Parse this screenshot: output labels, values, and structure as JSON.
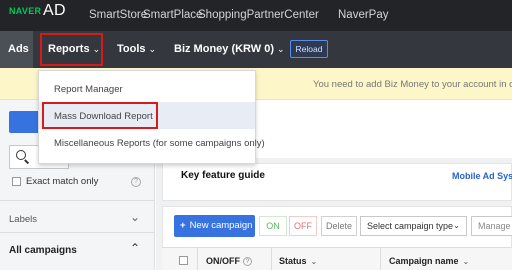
{
  "topbar": {
    "brand": "NAVER",
    "brand_ad": "AD",
    "links": [
      "SmartStore",
      "SmartPlace",
      "ShoppingPartnerCenter",
      "NaverPay"
    ]
  },
  "nav": {
    "ads": "Ads",
    "reports": "Reports",
    "tools": "Tools",
    "biz_money": "Biz Money (KRW 0)",
    "reload": "Reload"
  },
  "notice": {
    "text": "You need to add Biz Money to your account in order t"
  },
  "dropdown": {
    "items": [
      "Report Manager",
      "Mass Download Report",
      "Miscellaneous Reports (for some campaigns only)"
    ]
  },
  "sidebar": {
    "exact_match": "Exact match only",
    "labels": "Labels",
    "all_campaigns": "All campaigns"
  },
  "main": {
    "key_feature_title": "Key feature guide",
    "key_feature_right": "Mobile Ad Syst",
    "new_campaign": "New campaign",
    "on": "ON",
    "off": "OFF",
    "delete": "Delete",
    "select_type": "Select campaign type",
    "manage": "Manage s",
    "table_headers": [
      "ON/OFF",
      "Status",
      "Campaign name"
    ]
  },
  "colors": {
    "topbar_bg": "#222428",
    "navbar_bg": "#34373d",
    "brand_green": "#03c75a",
    "primary_blue": "#3773e0",
    "highlight_red": "#d61b1b",
    "notice_bg": "#fdf6c8"
  }
}
